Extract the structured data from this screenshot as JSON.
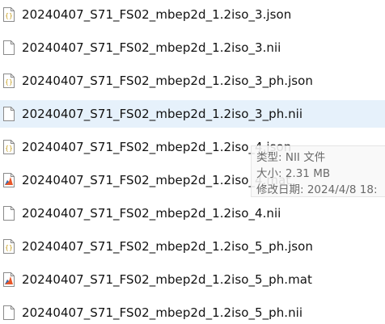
{
  "files": [
    {
      "name": "20240407_S71_FS02_mbep2d_1.2iso_3.json",
      "icon": "json-file-icon",
      "selected": false
    },
    {
      "name": "20240407_S71_FS02_mbep2d_1.2iso_3.nii",
      "icon": "blank-file-icon",
      "selected": false
    },
    {
      "name": "20240407_S71_FS02_mbep2d_1.2iso_3_ph.json",
      "icon": "json-file-icon",
      "selected": false
    },
    {
      "name": "20240407_S71_FS02_mbep2d_1.2iso_3_ph.nii",
      "icon": "blank-file-icon",
      "selected": true
    },
    {
      "name": "20240407_S71_FS02_mbep2d_1.2iso_4.json",
      "icon": "json-file-icon",
      "selected": false
    },
    {
      "name": "20240407_S71_FS02_mbep2d_1.2iso_4.mat",
      "icon": "matlab-file-icon",
      "selected": false
    },
    {
      "name": "20240407_S71_FS02_mbep2d_1.2iso_4.nii",
      "icon": "blank-file-icon",
      "selected": false
    },
    {
      "name": "20240407_S71_FS02_mbep2d_1.2iso_5_ph.json",
      "icon": "json-file-icon",
      "selected": false
    },
    {
      "name": "20240407_S71_FS02_mbep2d_1.2iso_5_ph.mat",
      "icon": "matlab-file-icon",
      "selected": false
    },
    {
      "name": "20240407_S71_FS02_mbep2d_1.2iso_5_ph.nii",
      "icon": "blank-file-icon",
      "selected": false
    }
  ],
  "tooltip": {
    "type_line": "类型: NII 文件",
    "size_line": "大小: 2.31 MB",
    "modified_line": "修改日期: 2024/4/8 18:"
  },
  "colors": {
    "selection_background": "#e6f1fb",
    "json_icon_accent": "#c9a227",
    "matlab_icon_accent": "#e8572a"
  }
}
